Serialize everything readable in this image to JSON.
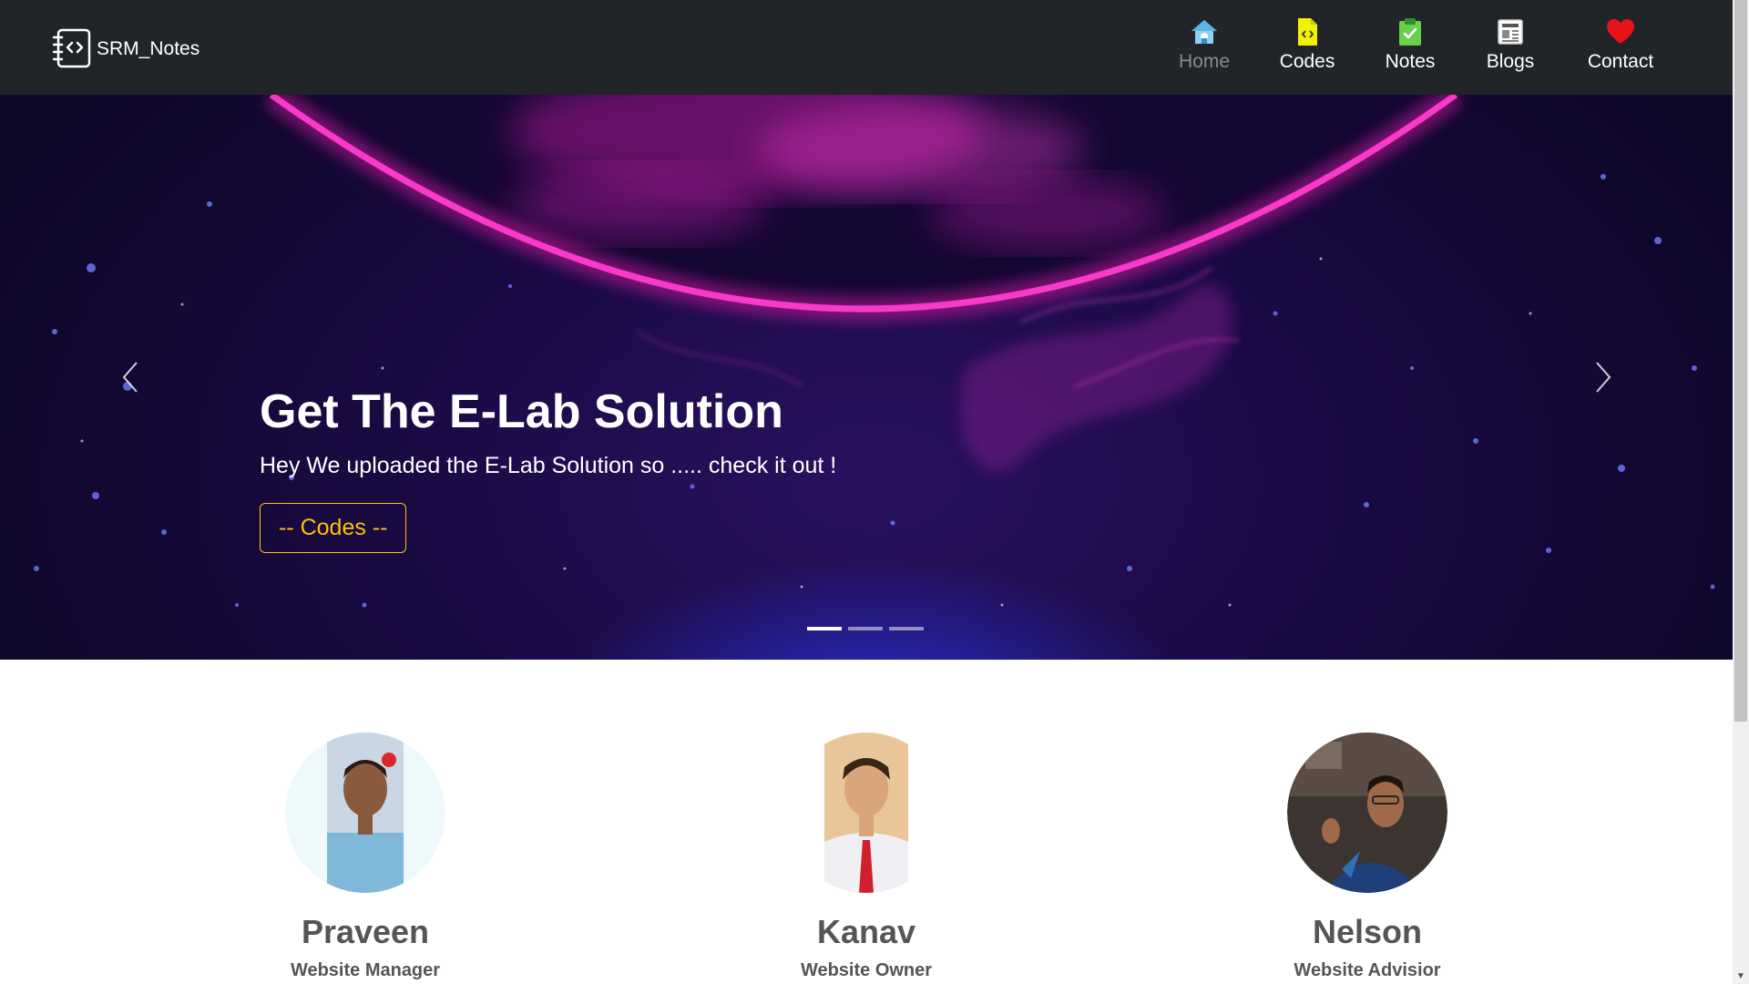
{
  "navbar": {
    "brand": "SRM_Notes",
    "items": [
      {
        "label": "Home",
        "icon": "home-icon",
        "active": true
      },
      {
        "label": "Codes",
        "icon": "code-file-icon",
        "active": false
      },
      {
        "label": "Notes",
        "icon": "clipboard-check-icon",
        "active": false
      },
      {
        "label": "Blogs",
        "icon": "newspaper-icon",
        "active": false
      },
      {
        "label": "Contact",
        "icon": "heart-icon",
        "active": false
      }
    ]
  },
  "hero": {
    "title": "Get The E-Lab Solution",
    "text": "Hey We uploaded the E-Lab Solution so ..... check it out !",
    "button": "-- Codes --",
    "slides": 3,
    "active_slide": 1
  },
  "team": [
    {
      "name": "Praveen",
      "role": "Website Manager"
    },
    {
      "name": "Kanav",
      "role": "Website Owner"
    },
    {
      "name": "Nelson",
      "role": "Website Advisior"
    }
  ],
  "colors": {
    "navbar_bg": "#212529",
    "accent_button": "#ffc107",
    "hero_magenta": "#ff1fb8",
    "team_text": "#555555"
  }
}
